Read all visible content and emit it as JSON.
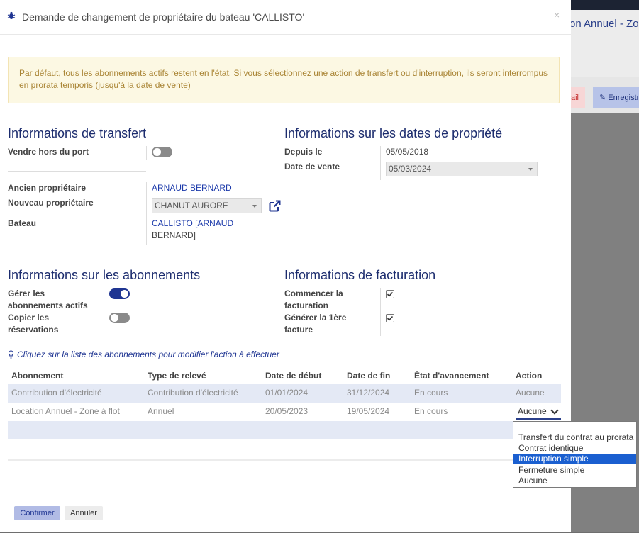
{
  "background": {
    "title": "on Annuel - Zo",
    "btn_red": "ail",
    "btn_save": "Enregistr"
  },
  "modal": {
    "title": "Demande de changement de propriétaire du bateau 'CALLISTO'",
    "close": "×",
    "alert": "Par défaut, tous les abonnements actifs restent en l'état. Si vous sélectionnez une action de transfert ou d'interruption, ils seront interrompus en prorata temporis (jusqu'à la date de vente)"
  },
  "transfer": {
    "title": "Informations de transfert",
    "sell_out_port_label": "Vendre hors du port",
    "sell_out_port_on": false,
    "old_owner_label": "Ancien propriétaire",
    "old_owner_value": "ARNAUD BERNARD",
    "new_owner_label": "Nouveau propriétaire",
    "new_owner_value": "CHANUT AURORE",
    "boat_label": "Bateau",
    "boat_value_line1": "CALLISTO [ARNAUD",
    "boat_value_line2": "BERNARD]"
  },
  "dates": {
    "title": "Informations sur les dates de propriété",
    "since_label": "Depuis le",
    "since_value": "05/05/2018",
    "sale_label": "Date de vente",
    "sale_value": "05/03/2024"
  },
  "subscriptions": {
    "title": "Informations sur les abonnements",
    "manage_label_1": "Gérer les",
    "manage_label_2": "abonnements actifs",
    "manage_on": true,
    "copy_label_1": "Copier les",
    "copy_label_2": "réservations",
    "copy_on": false
  },
  "billing": {
    "title": "Informations de facturation",
    "start_label_1": "Commencer la",
    "start_label_2": "facturation",
    "start_checked": true,
    "first_label_1": "Générer la 1ère",
    "first_label_2": "facture",
    "first_checked": true
  },
  "hint": "Cliquez sur la liste des abonnements pour modifier l'action à effectuer",
  "table": {
    "headers": [
      "Abonnement",
      "Type de relevé",
      "Date de début",
      "Date de fin",
      "État d'avancement",
      "Action"
    ],
    "rows": [
      [
        "Contribution d'électricité",
        "Contribution d'électricité",
        "01/01/2024",
        "31/12/2024",
        "En cours",
        "Aucune"
      ],
      [
        "Location Annuel - Zone à flot",
        "Annuel",
        "20/05/2023",
        "19/05/2024",
        "En cours",
        "Aucune"
      ]
    ]
  },
  "dropdown": {
    "options": [
      "Transfert du contrat au prorata",
      "Contrat identique",
      "Interruption simple",
      "Fermeture simple",
      "Aucune"
    ],
    "highlighted": "Interruption simple"
  },
  "footer": {
    "confirm": "Confirmer",
    "cancel": "Annuler"
  },
  "colors": {
    "primary": "#1f3592",
    "alert_bg": "#fcf8e3",
    "alert_text": "#a98434",
    "selection": "#1a5fd0"
  }
}
